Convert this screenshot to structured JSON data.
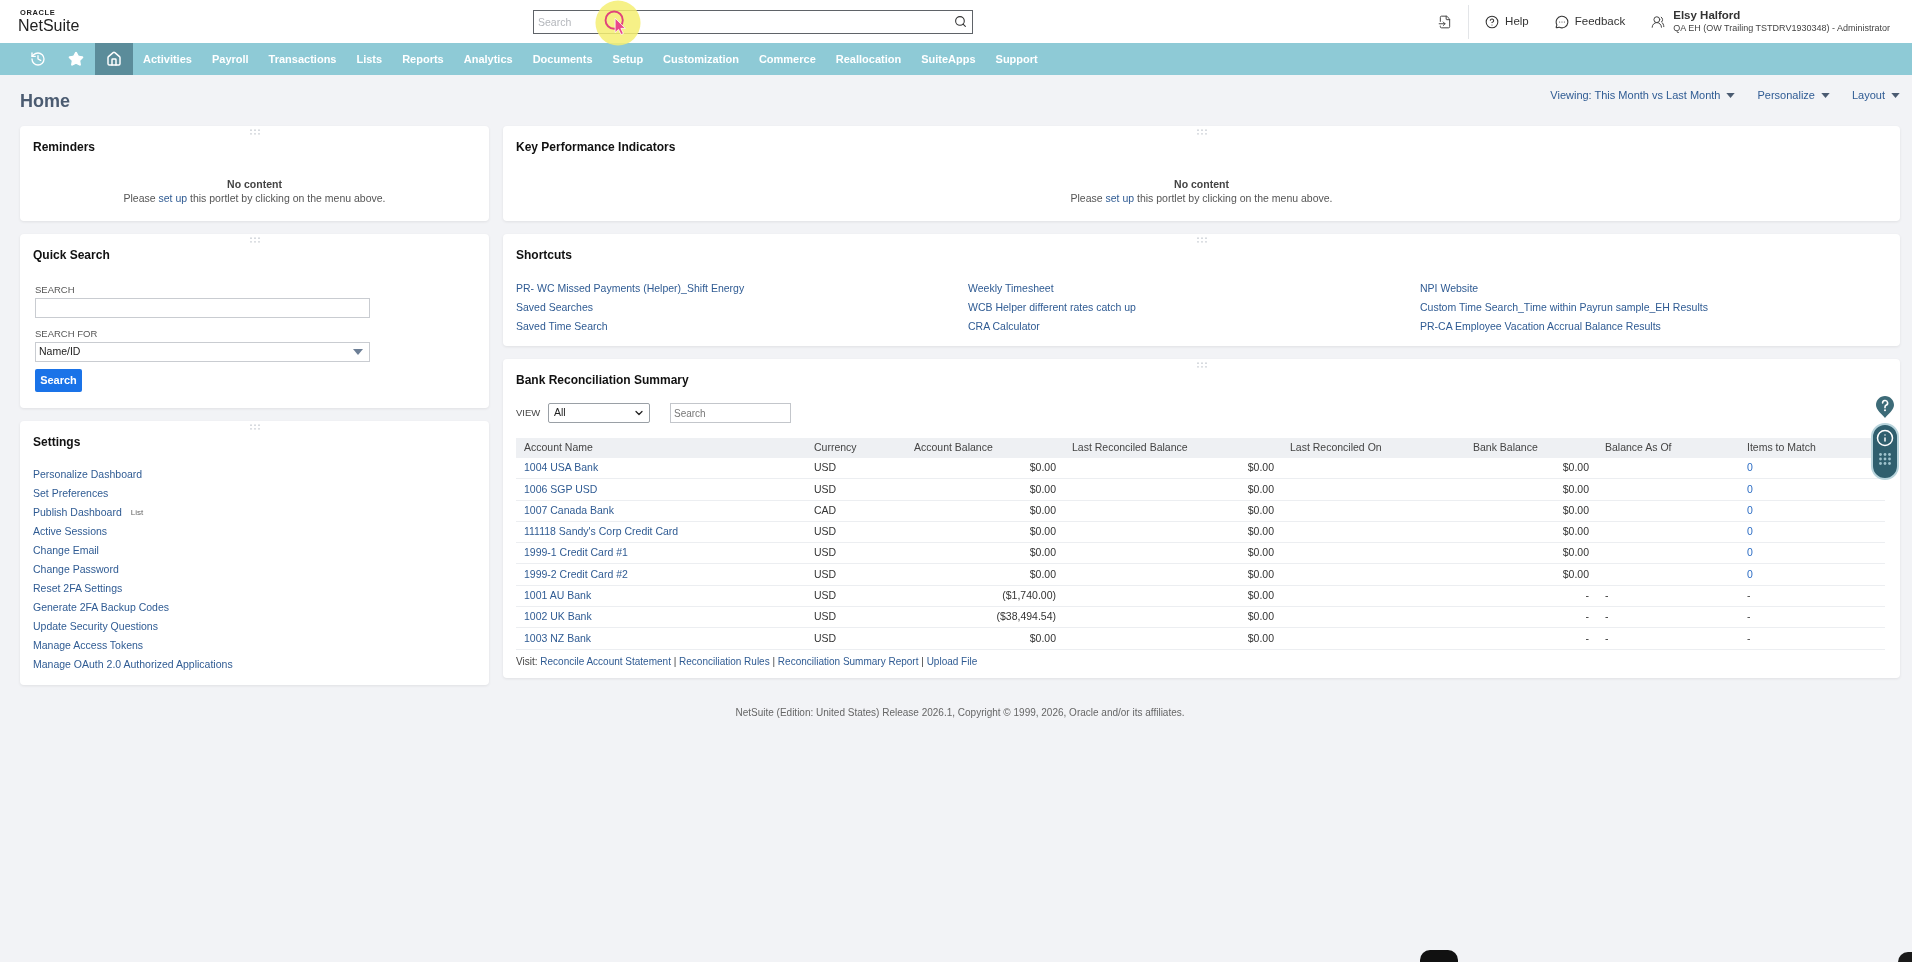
{
  "header": {
    "logo": {
      "vendor": "ORACLE",
      "product": "NetSuite"
    },
    "search": {
      "placeholder": "Search"
    },
    "actions": [
      {
        "kind": "help",
        "label": "Help"
      },
      {
        "kind": "feedback",
        "label": "Feedback"
      }
    ],
    "user": {
      "name": "Elsy Halford",
      "role": "QA EH (OW Trailing TSTDRV1930348) - Administrator"
    }
  },
  "nav": {
    "icon_items": [
      {
        "kind": "recent",
        "selected": false
      },
      {
        "kind": "favorites",
        "selected": false
      },
      {
        "kind": "home",
        "selected": true
      }
    ],
    "items": [
      {
        "label": "Activities",
        "selected": false
      },
      {
        "label": "Payroll",
        "selected": false
      },
      {
        "label": "Transactions",
        "selected": false
      },
      {
        "label": "Lists",
        "selected": false
      },
      {
        "label": "Reports",
        "selected": false
      },
      {
        "label": "Analytics",
        "selected": false
      },
      {
        "label": "Documents",
        "selected": false
      },
      {
        "label": "Setup",
        "selected": false
      },
      {
        "label": "Customization",
        "selected": false
      },
      {
        "label": "Commerce",
        "selected": false
      },
      {
        "label": "Reallocation",
        "selected": false
      },
      {
        "label": "SuiteApps",
        "selected": false
      },
      {
        "label": "Support",
        "selected": false
      }
    ]
  },
  "page": {
    "title": "Home",
    "controls": [
      "Viewing: This Month vs Last Month",
      "Personalize",
      "Layout"
    ]
  },
  "reminders": {
    "title": "Reminders",
    "empty": {
      "heading": "No content",
      "parts": [
        {
          "kind": "text",
          "text": "Please "
        },
        {
          "kind": "link",
          "text": "set up"
        },
        {
          "kind": "text",
          "text": " this portlet by clicking on the menu above."
        }
      ]
    }
  },
  "quick_search": {
    "title": "Quick Search",
    "search_label": "SEARCH",
    "search_for_label": "SEARCH FOR",
    "search_for_value": "Name/ID",
    "button": "Search"
  },
  "settings": {
    "title": "Settings",
    "links": [
      {
        "label": "Personalize Dashboard"
      },
      {
        "label": "Set Preferences"
      },
      {
        "label": "Publish Dashboard",
        "tag": "List"
      },
      {
        "label": "Active Sessions"
      },
      {
        "label": "Change Email"
      },
      {
        "label": "Change Password"
      },
      {
        "label": "Reset 2FA Settings"
      },
      {
        "label": "Generate 2FA Backup Codes"
      },
      {
        "label": "Update Security Questions"
      },
      {
        "label": "Manage Access Tokens"
      },
      {
        "label": "Manage OAuth 2.0 Authorized Applications"
      }
    ]
  },
  "kpi": {
    "title": "Key Performance Indicators",
    "empty": {
      "heading": "No content",
      "parts": [
        {
          "kind": "text",
          "text": "Please "
        },
        {
          "kind": "link",
          "text": "set up"
        },
        {
          "kind": "text",
          "text": " this portlet by clicking on the menu above."
        }
      ]
    }
  },
  "shortcuts": {
    "title": "Shortcuts",
    "links": [
      "PR- WC Missed Payments (Helper)_Shift Energy",
      "Weekly Timesheet",
      "NPI Website",
      "Saved Searches",
      "WCB Helper different rates catch up",
      "Custom Time Search_Time within Payrun sample_EH Results",
      "Saved Time Search",
      "CRA Calculator",
      "PR-CA Employee Vacation Accrual Balance Results"
    ]
  },
  "bank_reconciliation": {
    "title": "Bank Reconciliation Summary",
    "view_label": "VIEW",
    "view_value": "All",
    "search_placeholder": "Search",
    "columns": [
      "Account Name",
      "Currency",
      "Account Balance",
      "Last Reconciled Balance",
      "Last Reconciled On",
      "Bank Balance",
      "Balance As Of",
      "Items to Match"
    ],
    "rows": [
      {
        "account_name": "1004 USA Bank",
        "currency": "USD",
        "account_balance": "$0.00",
        "last_reconciled_balance": "$0.00",
        "bank_balance": "$0.00",
        "items_to_match": "0",
        "items_to_match_link": true
      },
      {
        "account_name": "1006 SGP USD",
        "currency": "USD",
        "account_balance": "$0.00",
        "last_reconciled_balance": "$0.00",
        "bank_balance": "$0.00",
        "items_to_match": "0",
        "items_to_match_link": true
      },
      {
        "account_name": "1007 Canada Bank",
        "currency": "CAD",
        "account_balance": "$0.00",
        "last_reconciled_balance": "$0.00",
        "bank_balance": "$0.00",
        "items_to_match": "0",
        "items_to_match_link": true
      },
      {
        "account_name": "111118 Sandy's Corp Credit Card",
        "currency": "USD",
        "account_balance": "$0.00",
        "last_reconciled_balance": "$0.00",
        "bank_balance": "$0.00",
        "items_to_match": "0",
        "items_to_match_link": true
      },
      {
        "account_name": "1999-1 Credit Card #1",
        "currency": "USD",
        "account_balance": "$0.00",
        "last_reconciled_balance": "$0.00",
        "bank_balance": "$0.00",
        "items_to_match": "0",
        "items_to_match_link": true
      },
      {
        "account_name": "1999-2 Credit Card #2",
        "currency": "USD",
        "account_balance": "$0.00",
        "last_reconciled_balance": "$0.00",
        "bank_balance": "$0.00",
        "items_to_match": "0",
        "items_to_match_link": true
      },
      {
        "account_name": "1001 AU Bank",
        "currency": "USD",
        "account_balance": "($1,740.00)",
        "last_reconciled_balance": "$0.00",
        "bank_balance": "-",
        "balance_as_of": "-",
        "items_to_match": "-",
        "items_to_match_link": false
      },
      {
        "account_name": "1002 UK Bank",
        "currency": "USD",
        "account_balance": "($38,494.54)",
        "last_reconciled_balance": "$0.00",
        "bank_balance": "-",
        "balance_as_of": "-",
        "items_to_match": "-",
        "items_to_match_link": false
      },
      {
        "account_name": "1003 NZ Bank",
        "currency": "USD",
        "account_balance": "$0.00",
        "last_reconciled_balance": "$0.00",
        "bank_balance": "-",
        "balance_as_of": "-",
        "items_to_match": "-",
        "items_to_match_link": false
      }
    ],
    "visit": [
      {
        "kind": "text",
        "text": "Visit: "
      },
      {
        "kind": "link",
        "text": "Reconcile Account Statement"
      },
      {
        "kind": "text",
        "text": " | "
      },
      {
        "kind": "link",
        "text": "Reconciliation Rules"
      },
      {
        "kind": "text",
        "text": " | "
      },
      {
        "kind": "link",
        "text": "Reconciliation Summary Report"
      },
      {
        "kind": "text",
        "text": " | "
      },
      {
        "kind": "link",
        "text": "Upload File"
      }
    ]
  },
  "footer": "NetSuite (Edition: United States) Release 2026.1, Copyright © 1999, 2026, Oracle and/or its affiliates."
}
